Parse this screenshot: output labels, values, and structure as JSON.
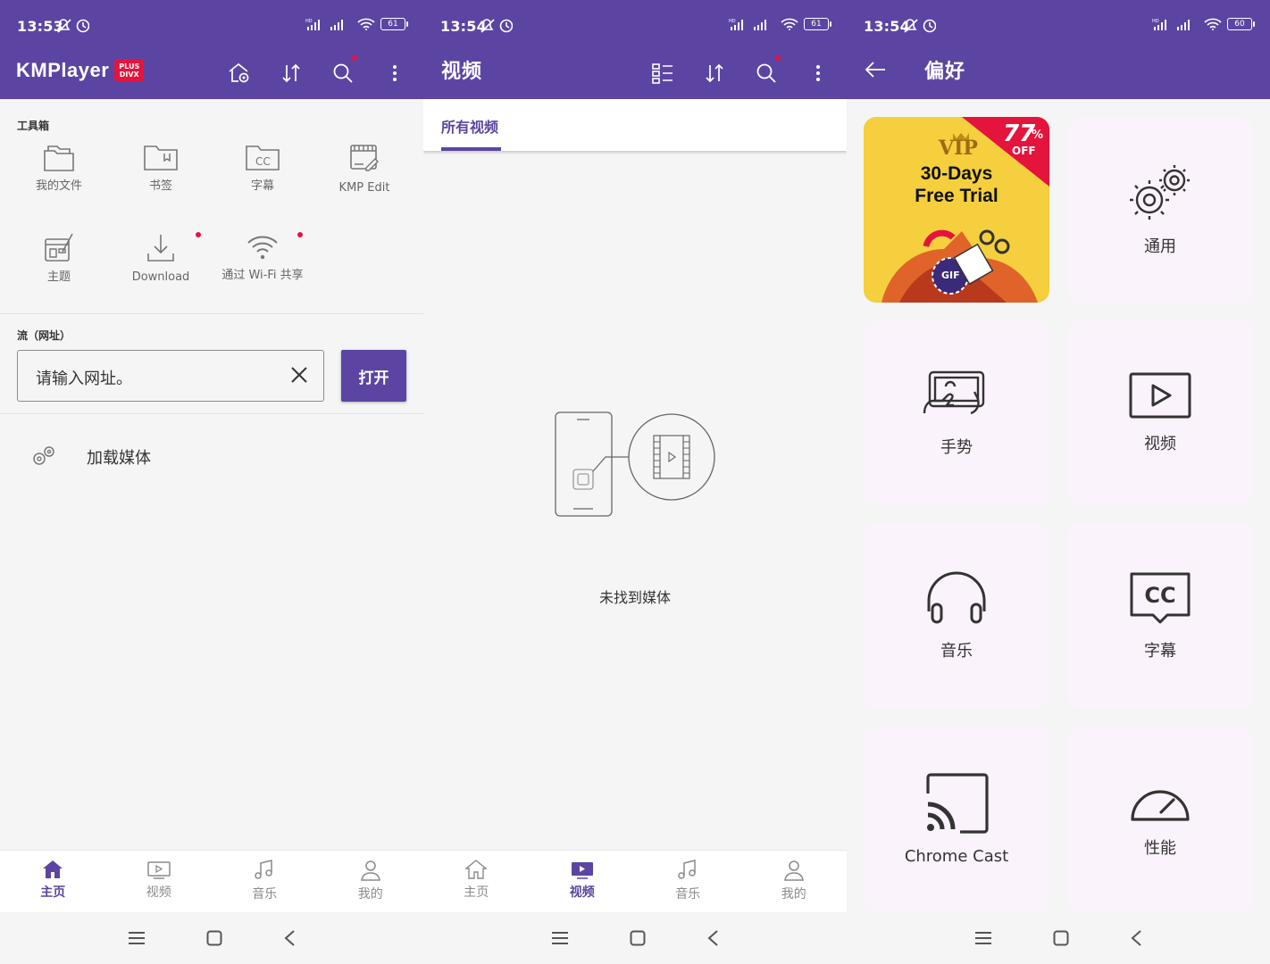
{
  "colors": {
    "brand": "#5c45a2",
    "accent_red": "#e5143c",
    "tile_bg": "#fbf3fb"
  },
  "panel1": {
    "status": {
      "time": "13:53",
      "battery": "61"
    },
    "logo": {
      "brand": "KMPlayer",
      "badge_line1": "PLUS",
      "badge_line2": "DIVX"
    },
    "toolbox": {
      "label": "工具箱",
      "items": [
        {
          "label": "我的文件",
          "icon": "folder-icon"
        },
        {
          "label": "书签",
          "icon": "bookmark-folder-icon"
        },
        {
          "label": "字幕",
          "icon": "subtitle-folder-icon"
        },
        {
          "label": "KMP Edit",
          "icon": "kmp-edit-icon"
        },
        {
          "label": "主题",
          "icon": "theme-icon"
        },
        {
          "label": "Download",
          "icon": "download-icon"
        },
        {
          "label": "通过 Wi-Fi 共享",
          "icon": "wifi-share-icon"
        }
      ]
    },
    "stream": {
      "label": "流（网址）",
      "placeholder": "请输入网址。",
      "open_label": "打开"
    },
    "load_media": "加载媒体"
  },
  "panel2": {
    "status": {
      "time": "13:54",
      "battery": "61"
    },
    "title": "视频",
    "tab": "所有视频",
    "empty": "未找到媒体"
  },
  "panel3": {
    "status": {
      "time": "13:54",
      "battery": "60"
    },
    "title": "偏好",
    "promo": {
      "vip": "VIP",
      "discount": "77",
      "percent": "%",
      "off": "OFF",
      "line1": "30-Days",
      "line2": "Free Trial",
      "gif": "GIF"
    },
    "tiles": [
      {
        "label": "通用",
        "icon": "gears-icon"
      },
      {
        "label": "手势",
        "icon": "gesture-icon"
      },
      {
        "label": "视频",
        "icon": "video-play-icon"
      },
      {
        "label": "音乐",
        "icon": "headphones-icon"
      },
      {
        "label": "字幕",
        "icon": "cc-icon"
      },
      {
        "label": "Chrome Cast",
        "icon": "cast-icon"
      },
      {
        "label": "性能",
        "icon": "speedometer-icon"
      }
    ]
  },
  "bottom_nav": [
    "主页",
    "视频",
    "音乐",
    "我的"
  ]
}
